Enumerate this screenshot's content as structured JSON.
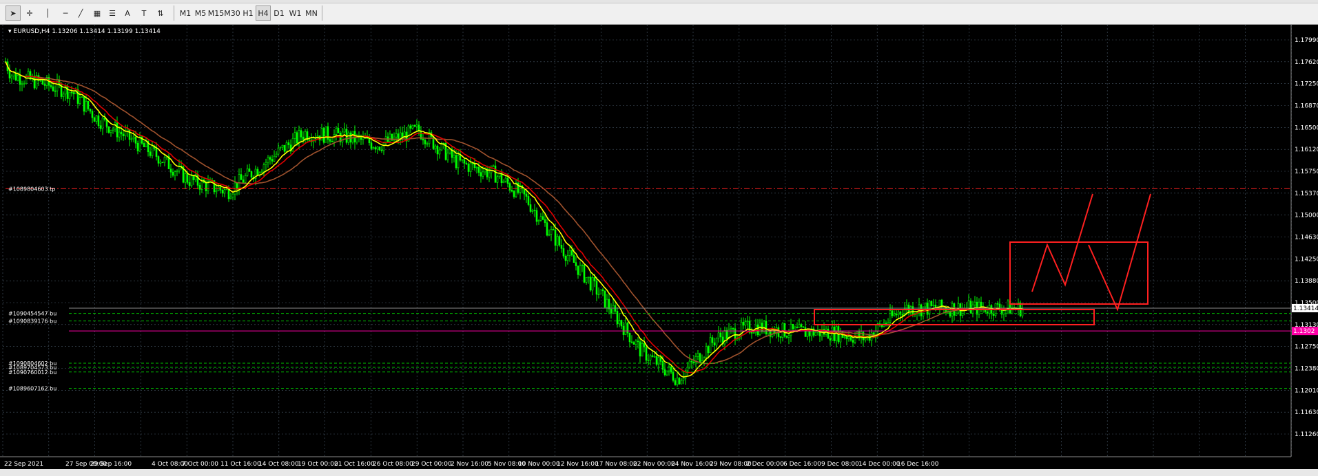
{
  "toolbar": {
    "tools": [
      {
        "name": "cursor-tool",
        "glyph": "➤"
      },
      {
        "name": "crosshair-tool",
        "glyph": "✛"
      },
      {
        "name": "vertical-line-tool",
        "glyph": "│"
      },
      {
        "name": "horizontal-line-tool",
        "glyph": "─"
      },
      {
        "name": "trendline-tool",
        "glyph": "╱"
      },
      {
        "name": "channel-tool",
        "glyph": "▦"
      },
      {
        "name": "fibonacci-tool",
        "glyph": "☰"
      },
      {
        "name": "text-tool",
        "glyph": "A"
      },
      {
        "name": "text-label-tool",
        "glyph": "T"
      },
      {
        "name": "arrows-tool",
        "glyph": "⇅"
      }
    ],
    "timeframes": [
      "M1",
      "M5",
      "M15",
      "M30",
      "H1",
      "H4",
      "D1",
      "W1",
      "MN"
    ],
    "active_timeframe": "H4"
  },
  "chart": {
    "header": "EURUSD,H4  1.13206 1.13414 1.13199 1.13414",
    "background": "#000000",
    "candle_color": "#00ff00",
    "grid_color": "#4a5a6a",
    "current_price_label": "1.13414",
    "pink_price_label": "1.1302",
    "price_axis": [
      "1.17990",
      "1.17620",
      "1.17250",
      "1.16870",
      "1.16500",
      "1.16120",
      "1.15750",
      "1.15370",
      "1.15000",
      "1.14630",
      "1.14250",
      "1.13880",
      "1.13500",
      "1.13130",
      "1.12750",
      "1.12380",
      "1.12010",
      "1.11630",
      "1.11260"
    ],
    "time_axis": [
      "22 Sep 2021",
      "27 Sep 00:00",
      "29 Sep 16:00",
      "4 Oct 08:00",
      "7 Oct 00:00",
      "11 Oct 16:00",
      "14 Oct 08:00",
      "19 Oct 00:00",
      "21 Oct 16:00",
      "26 Oct 08:00",
      "29 Oct 00:00",
      "2 Nov 16:00",
      "5 Nov 08:00",
      "10 Nov 00:00",
      "12 Nov 16:00",
      "17 Nov 08:00",
      "22 Nov 00:00",
      "24 Nov 16:00",
      "29 Nov 08:00",
      "2 Dec 00:00",
      "6 Dec 16:00",
      "9 Dec 08:00",
      "14 Dec 00:00",
      "16 Dec 16:00"
    ],
    "order_labels": [
      {
        "text": "#1089804603 tp",
        "price": 1.1545,
        "color": "#ff2020",
        "style": "dashdot"
      },
      {
        "text": "#1090454547 bu",
        "price": 1.1332,
        "color": "#00c000",
        "style": "dash"
      },
      {
        "text": "#1090839176 bu",
        "price": 1.1319,
        "color": "#00c000",
        "style": "dash"
      },
      {
        "text": "#1090804602 bu",
        "price": 1.1247,
        "color": "#00c000",
        "style": "dash"
      },
      {
        "text": "#1089704573 bu",
        "price": 1.124,
        "color": "#00c000",
        "style": "dash"
      },
      {
        "text": "#1090760012 bu",
        "price": 1.1232,
        "color": "#00c000",
        "style": "dash"
      },
      {
        "text": "#1089607162 bu",
        "price": 1.1204,
        "color": "#00c000",
        "style": "dash"
      }
    ],
    "moving_averages": [
      {
        "name": "fast",
        "color": "#ffff00"
      },
      {
        "name": "medium",
        "color": "#e00000"
      },
      {
        "name": "slow",
        "color": "#a0522d"
      }
    ]
  },
  "chart_data": {
    "type": "candlestick",
    "symbol": "EURUSD",
    "timeframe": "H4",
    "ylim": [
      1.1126,
      1.1799
    ],
    "x": [
      "22 Sep 2021",
      "27 Sep 00:00",
      "29 Sep 16:00",
      "4 Oct 08:00",
      "7 Oct 00:00",
      "11 Oct 16:00",
      "14 Oct 08:00",
      "19 Oct 00:00",
      "21 Oct 16:00",
      "26 Oct 08:00",
      "29 Oct 00:00",
      "2 Nov 16:00",
      "5 Nov 08:00",
      "10 Nov 00:00",
      "12 Nov 16:00",
      "17 Nov 08:00",
      "22 Nov 00:00",
      "24 Nov 16:00",
      "29 Nov 08:00",
      "2 Dec 00:00",
      "6 Dec 16:00",
      "9 Dec 08:00",
      "14 Dec 00:00",
      "16 Dec 16:00"
    ],
    "close": [
      1.174,
      1.171,
      1.1665,
      1.16,
      1.156,
      1.154,
      1.159,
      1.164,
      1.1635,
      1.162,
      1.1645,
      1.159,
      1.157,
      1.153,
      1.144,
      1.136,
      1.127,
      1.122,
      1.129,
      1.131,
      1.13,
      1.13,
      1.129,
      1.1341
    ],
    "horizontal_levels": [
      1.1545,
      1.1341,
      1.1332,
      1.1319,
      1.1302,
      1.1247,
      1.124,
      1.1232,
      1.1204
    ]
  }
}
